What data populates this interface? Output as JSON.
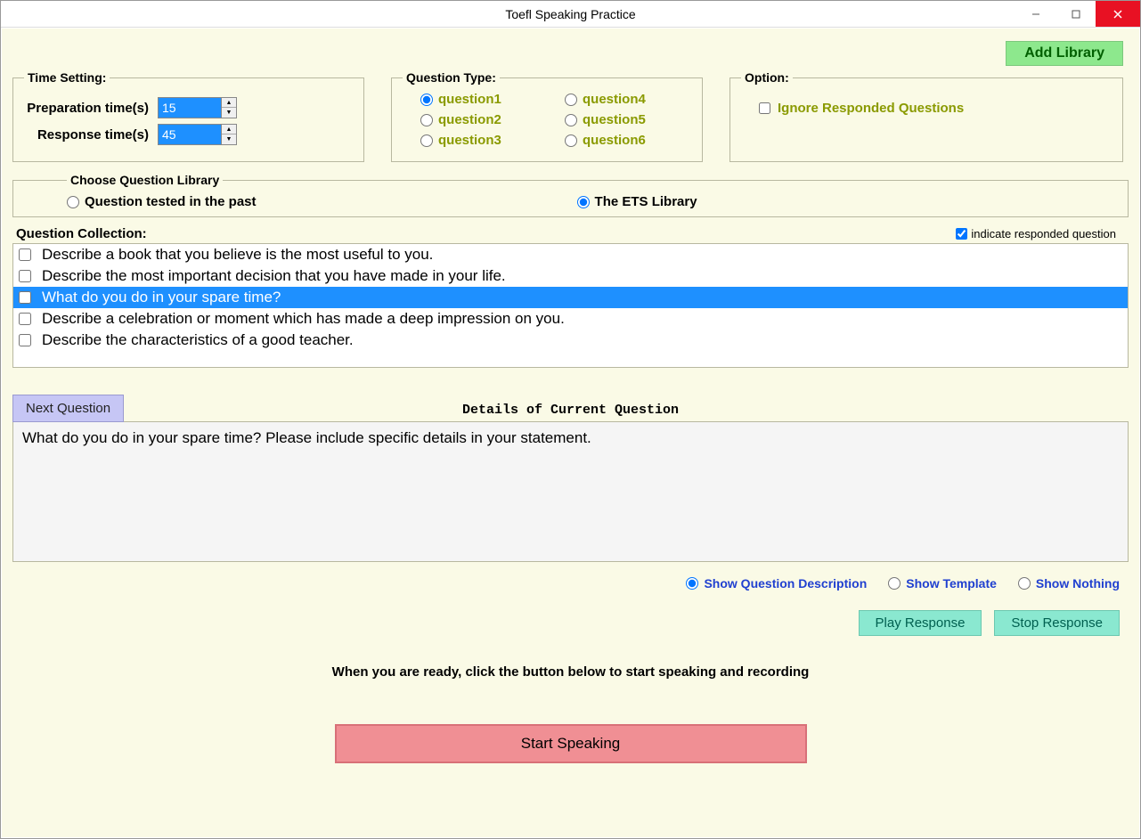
{
  "window": {
    "title": "Toefl Speaking Practice"
  },
  "buttons": {
    "add_library": "Add Library",
    "next_question": "Next Question",
    "play_response": "Play Response",
    "stop_response": "Stop Response",
    "start_speaking": "Start Speaking"
  },
  "time_setting": {
    "legend": "Time Setting:",
    "prep_label": "Preparation time(s)",
    "prep_value": "15",
    "resp_label": "Response time(s)",
    "resp_value": "45"
  },
  "question_type": {
    "legend": "Question Type:",
    "items": [
      "question1",
      "question2",
      "question3",
      "question4",
      "question5",
      "question6"
    ],
    "selected": 0
  },
  "option": {
    "legend": "Option:",
    "ignore_label": "Ignore Responded Questions"
  },
  "choose_library": {
    "legend": "Choose Question Library",
    "past_label": "Question tested in the past",
    "ets_label": "The ETS Library"
  },
  "question_collection": {
    "title": "Question Collection:",
    "indicate_label": "indicate responded question",
    "items": [
      "Describe a book that you believe is the most useful to you.",
      "Describe the most important decision that you have made in your life.",
      "What do you do in your spare time?",
      "Describe a celebration or moment which has made a deep impression on you.",
      "Describe the characteristics of a good teacher."
    ],
    "selected_index": 2
  },
  "details": {
    "title": "Details of Current Question",
    "text": "What do you do in your spare time? Please include specific details in your statement."
  },
  "show_options": {
    "desc": "Show Question Description",
    "template": "Show Template",
    "nothing": "Show Nothing"
  },
  "ready_text": "When you are ready, click the button below to start speaking and recording"
}
